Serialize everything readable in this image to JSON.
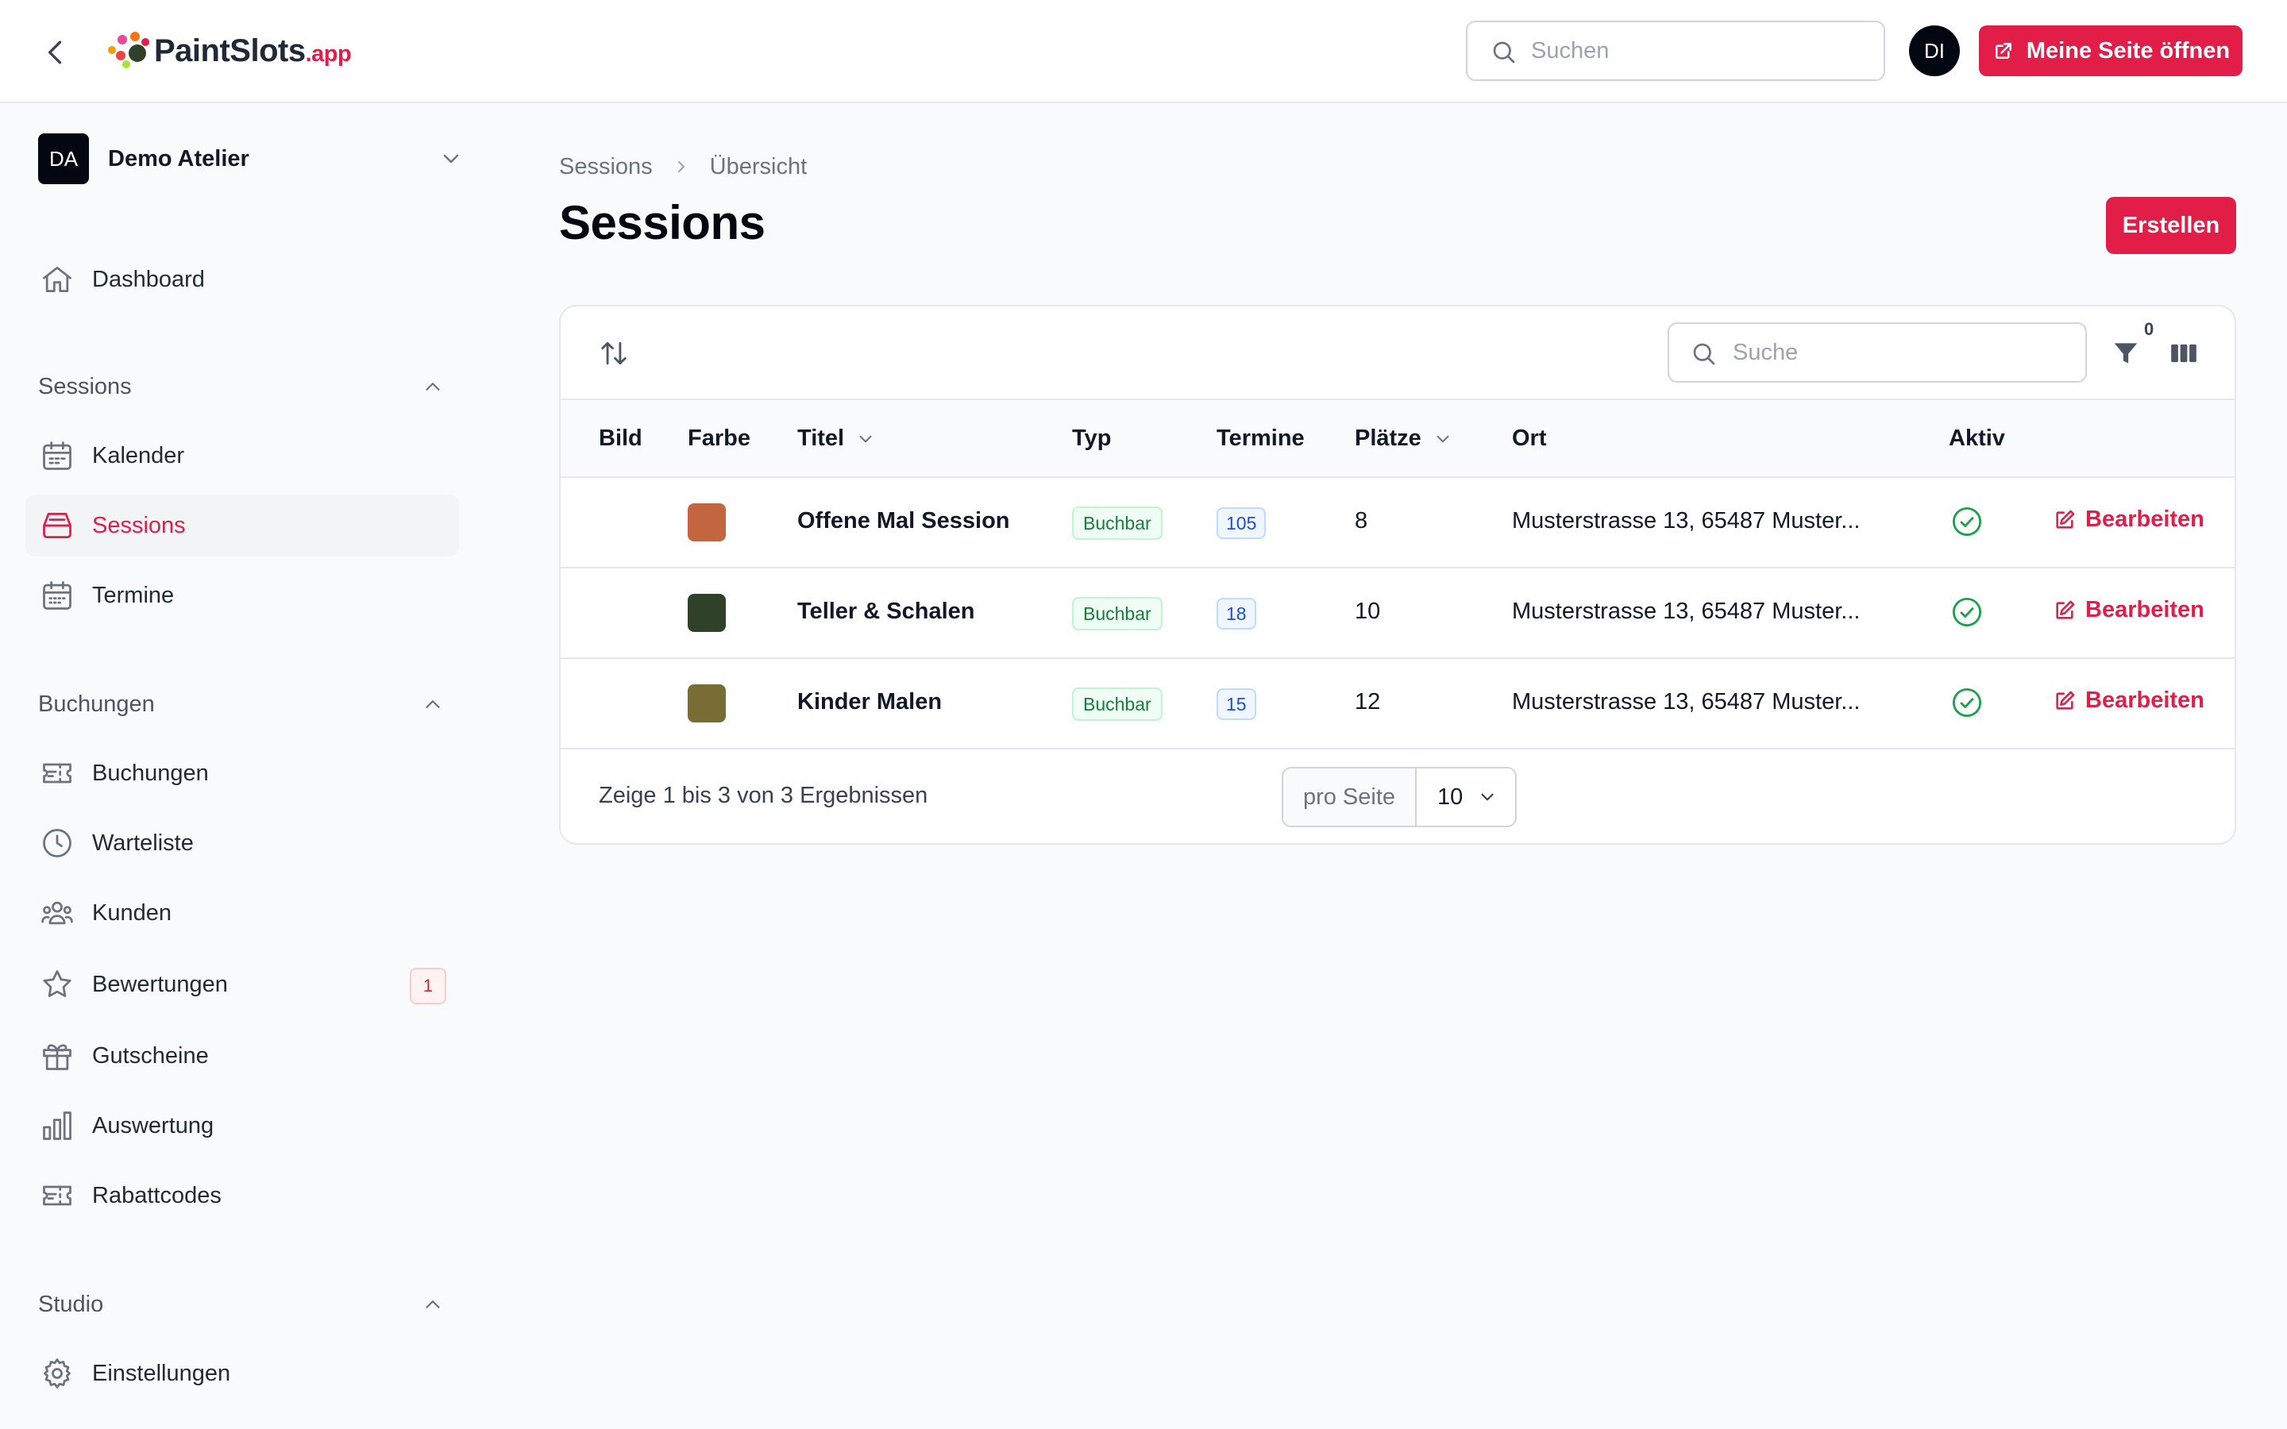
{
  "header": {
    "logo_main": "PaintSlots",
    "logo_suffix": ".app",
    "search_placeholder": "Suchen",
    "user_initials": "DI",
    "open_site_label": "Meine Seite öffnen"
  },
  "tenant": {
    "initials": "DA",
    "name": "Demo Atelier"
  },
  "sidebar": {
    "dashboard": {
      "label": "Dashboard",
      "icon": "home-icon"
    },
    "groups": [
      {
        "label": "Sessions",
        "items": [
          {
            "label": "Kalender",
            "icon": "calendar-icon"
          },
          {
            "label": "Sessions",
            "icon": "inbox-icon",
            "active": true
          },
          {
            "label": "Termine",
            "icon": "calendar-days-icon"
          }
        ]
      },
      {
        "label": "Buchungen",
        "items": [
          {
            "label": "Buchungen",
            "icon": "ticket-icon"
          },
          {
            "label": "Warteliste",
            "icon": "clock-icon"
          },
          {
            "label": "Kunden",
            "icon": "users-icon"
          },
          {
            "label": "Bewertungen",
            "icon": "star-icon",
            "badge": "1"
          },
          {
            "label": "Gutscheine",
            "icon": "gift-icon"
          },
          {
            "label": "Auswertung",
            "icon": "chart-bar-icon"
          },
          {
            "label": "Rabattcodes",
            "icon": "ticket-icon"
          }
        ]
      },
      {
        "label": "Studio",
        "items": [
          {
            "label": "Einstellungen",
            "icon": "cog-icon"
          }
        ]
      }
    ]
  },
  "breadcrumb": {
    "parent": "Sessions",
    "current": "Übersicht"
  },
  "page": {
    "title": "Sessions",
    "create_label": "Erstellen"
  },
  "table": {
    "search_placeholder": "Suche",
    "filter_count": "0",
    "columns": [
      "Bild",
      "Farbe",
      "Titel",
      "Typ",
      "Termine",
      "Plätze",
      "Ort",
      "Aktiv"
    ],
    "rows": [
      {
        "color": "#c2663f",
        "title": "Offene Mal Session",
        "typ": "Buchbar",
        "termine": "105",
        "plaetze": "8",
        "ort": "Musterstrasse 13, 65487 Muster...",
        "aktiv": true,
        "action": "Bearbeiten"
      },
      {
        "color": "#2f4229",
        "title": "Teller & Schalen",
        "typ": "Buchbar",
        "termine": "18",
        "plaetze": "10",
        "ort": "Musterstrasse 13, 65487 Muster...",
        "aktiv": true,
        "action": "Bearbeiten"
      },
      {
        "color": "#776d35",
        "title": "Kinder Malen",
        "typ": "Buchbar",
        "termine": "15",
        "plaetze": "12",
        "ort": "Musterstrasse 13, 65487 Muster...",
        "aktiv": true,
        "action": "Bearbeiten"
      }
    ],
    "results_text": "Zeige 1 bis 3 von 3 Ergebnissen",
    "per_page_label": "pro Seite",
    "per_page_value": "10"
  },
  "colors": {
    "accent": "#e11d48",
    "success": "#16a34a"
  }
}
